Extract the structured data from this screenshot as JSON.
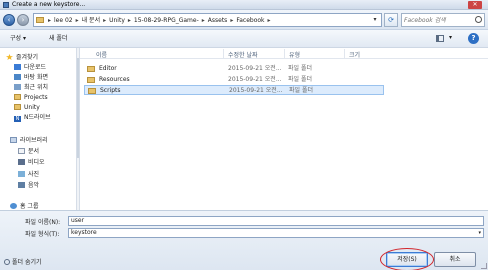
{
  "window": {
    "title": "Create a new keystore..."
  },
  "address": {
    "crumbs": [
      "lee 02",
      "내 문서",
      "Unity",
      "15-08-29-RPG_Game-",
      "Assets",
      "Facebook"
    ]
  },
  "search": {
    "placeholder": "Facebook 검색"
  },
  "toolbar": {
    "organize": "구성 ▾",
    "new_folder": "새 폴더"
  },
  "nav": {
    "favorites": "즐겨찾기",
    "downloads": "다운로드",
    "desktop": "바탕 화면",
    "recent": "최근 위치",
    "projects": "Projects",
    "unity": "Unity",
    "ndrive": "N드라이브",
    "libraries": "라이브러리",
    "documents": "문서",
    "videos": "비디오",
    "pictures": "사진",
    "music": "음악",
    "homegroup": "홈 그룹"
  },
  "columns": {
    "name": "이름",
    "date": "수정한 날짜",
    "type": "유형",
    "size": "크기"
  },
  "files": [
    {
      "name": "Editor",
      "date": "2015-09-21 오전...",
      "type": "파일 폴더"
    },
    {
      "name": "Resources",
      "date": "2015-09-21 오전...",
      "type": "파일 폴더"
    },
    {
      "name": "Scripts",
      "date": "2015-09-21 오전...",
      "type": "파일 폴더"
    }
  ],
  "form": {
    "filename_label": "파일 이름(N):",
    "filename_value": "user",
    "filetype_label": "파일 형식(T):",
    "filetype_value": "keystore"
  },
  "footer": {
    "hide_folders": "폴더 숨기기",
    "save": "저장(S)",
    "cancel": "취소"
  },
  "colors": {
    "annotation": "#d2252b",
    "selection": "#dcebfc"
  }
}
